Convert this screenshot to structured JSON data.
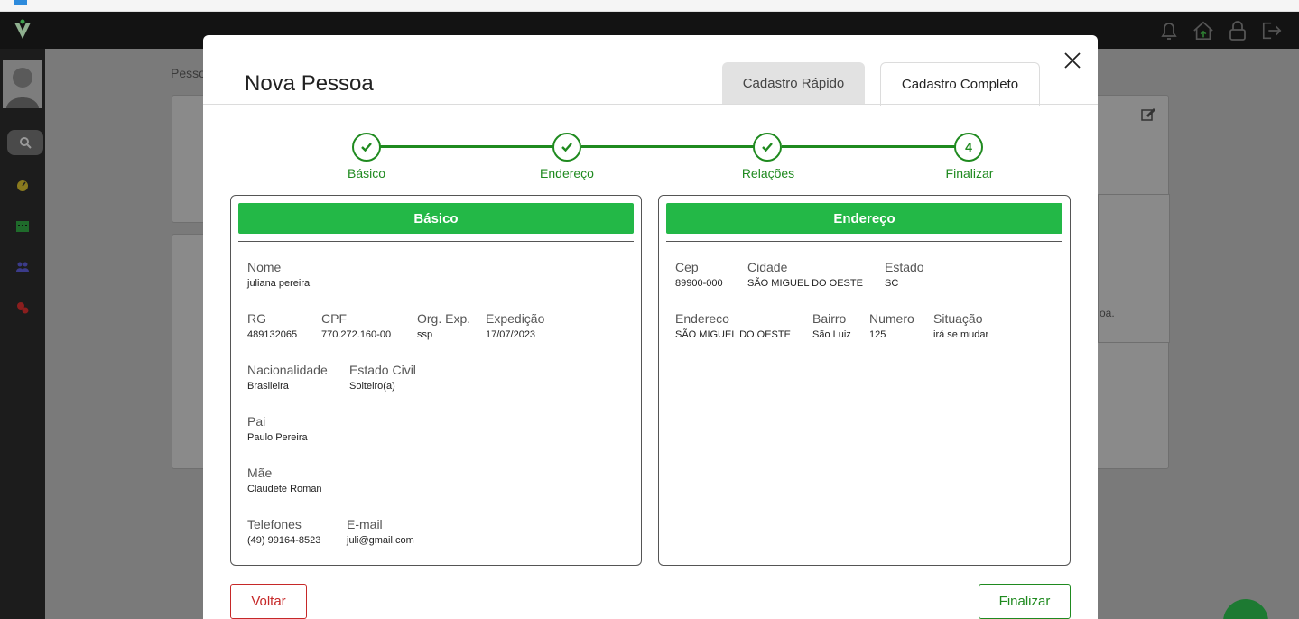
{
  "background": {
    "breadcrumb": "Pesso",
    "side_text": "oa."
  },
  "modal": {
    "title": "Nova Pessoa",
    "tabs": [
      {
        "label": "Cadastro Rápido",
        "active": false
      },
      {
        "label": "Cadastro Completo",
        "active": true
      }
    ]
  },
  "stepper": {
    "steps": [
      {
        "label": "Básico",
        "state": "done"
      },
      {
        "label": "Endereço",
        "state": "done"
      },
      {
        "label": "Relações",
        "state": "done"
      },
      {
        "label": "Finalizar",
        "state": "current",
        "number": "4"
      }
    ]
  },
  "basico": {
    "title": "Básico",
    "nome": {
      "label": "Nome",
      "value": "juliana pereira"
    },
    "rg": {
      "label": "RG",
      "value": "489132065"
    },
    "cpf": {
      "label": "CPF",
      "value": "770.272.160-00"
    },
    "org_exp": {
      "label": "Org. Exp.",
      "value": "ssp"
    },
    "expedicao": {
      "label": "Expedição",
      "value": "17/07/2023"
    },
    "nacionalidade": {
      "label": "Nacionalidade",
      "value": "Brasileira"
    },
    "estado_civil": {
      "label": "Estado Civil",
      "value": "Solteiro(a)"
    },
    "pai": {
      "label": "Pai",
      "value": "Paulo Pereira"
    },
    "mae": {
      "label": "Mãe",
      "value": "Claudete Roman"
    },
    "telefones": {
      "label": "Telefones",
      "value": "(49) 99164-8523"
    },
    "email": {
      "label": "E-mail",
      "value": "juli@gmail.com"
    }
  },
  "endereco": {
    "title": "Endereço",
    "cep": {
      "label": "Cep",
      "value": "89900-000"
    },
    "cidade": {
      "label": "Cidade",
      "value": "SÃO MIGUEL DO OESTE"
    },
    "estado": {
      "label": "Estado",
      "value": "SC"
    },
    "endereco": {
      "label": "Endereco",
      "value": "SÃO MIGUEL DO OESTE"
    },
    "bairro": {
      "label": "Bairro",
      "value": "São Luiz"
    },
    "numero": {
      "label": "Numero",
      "value": "125"
    },
    "situacao": {
      "label": "Situação",
      "value": "irá se mudar"
    }
  },
  "footer": {
    "back_label": "Voltar",
    "finish_label": "Finalizar"
  },
  "colors": {
    "accent_green": "#1f8a1f",
    "header_green": "#23b847",
    "danger_red": "#c62828"
  }
}
